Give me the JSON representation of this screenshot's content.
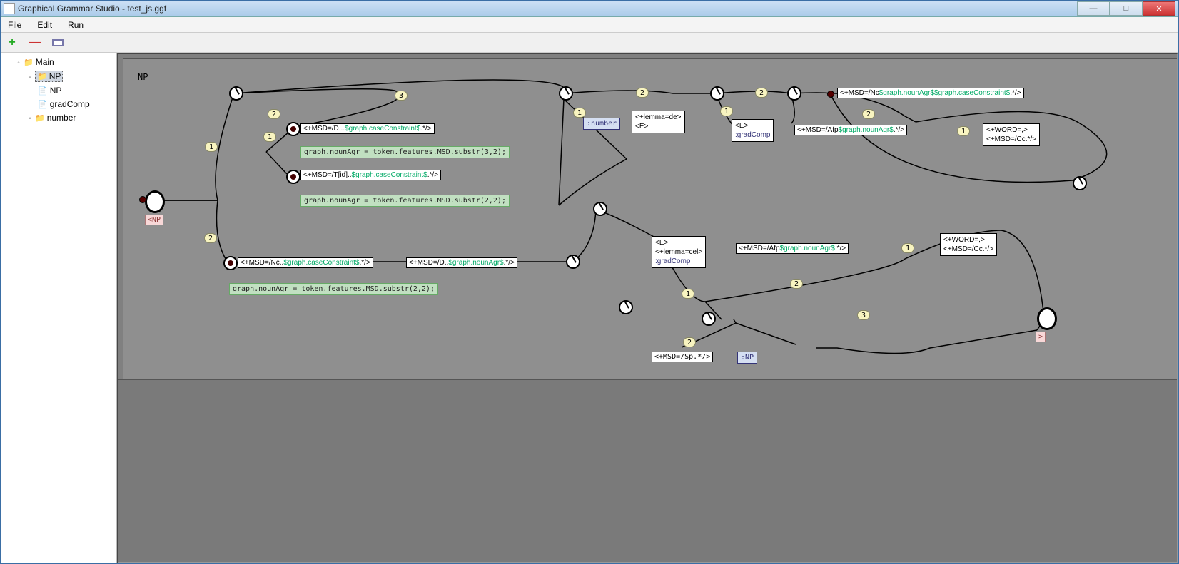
{
  "window": {
    "title": "Graphical Grammar Studio - test_js.ggf"
  },
  "menu": {
    "file": "File",
    "edit": "Edit",
    "run": "Run"
  },
  "tree": {
    "main": "Main",
    "np_folder": "NP",
    "np": "NP",
    "gradComp": "gradComp",
    "number": "number"
  },
  "graph": {
    "title": "NP",
    "startlabel": "<NP",
    "endlabel": ">",
    "tag_number": ":number",
    "tag_gradComp": ":gradComp",
    "box_lemma_de_1": "<+lemma=de>",
    "box_lemma_de_2": "<E>",
    "box_e1": "<E>",
    "box_cel_1": "<E>",
    "box_cel_2": "<+lemma=cel>",
    "msd_d": "<+MSD=/D...",
    "msd_d_var": "$graph.caseConstraint$",
    "msd_d_end": ".*/>",
    "grn1": "graph.nounAgr = token.features.MSD.substr(3,2);",
    "msd_t": "<+MSD=/T[id]..",
    "msd_t_var": "$graph.caseConstraint$",
    "msd_t_end": ".*/>",
    "grn2": "graph.nounAgr = token.features.MSD.substr(2,2);",
    "msd_nc_bot": "<+MSD=/Nc..",
    "msd_nc_bot_var": "$graph.caseConstraint$",
    "msd_nc_bot_end": ".*/>",
    "grn3": "graph.nounAgr = token.features.MSD.substr(2,2);",
    "msd_d2": "<+MSD=/D..",
    "msd_d2_var": "$graph.nounAgr$",
    "msd_d2_end": ".*/>",
    "msd_nc_top": "<+MSD=/Nc",
    "msd_nc_top_var1": "$graph.nounAgr$",
    "msd_nc_top_var2": "$graph.caseConstraint$",
    "msd_nc_top_end": ".*/>",
    "msd_afp1": "<+MSD=/Afp",
    "msd_afp1_var": "$graph.nounAgr$",
    "msd_afp1_end": ".*/>",
    "msd_afp2": "<+MSD=/Afp",
    "msd_afp2_var": "$graph.nounAgr$",
    "msd_afp2_end": ".*/>",
    "wordcc1_1": "<+WORD=,>",
    "wordcc1_2": "<+MSD=/Cc.*/>",
    "wordcc2_1": "<+WORD=,>",
    "wordcc2_2": "<+MSD=/Cc.*/>",
    "msd_sp": "<+MSD=/Sp.*/>",
    "tag_np": ":NP",
    "n1": "1",
    "n2": "2",
    "n3": "3"
  }
}
